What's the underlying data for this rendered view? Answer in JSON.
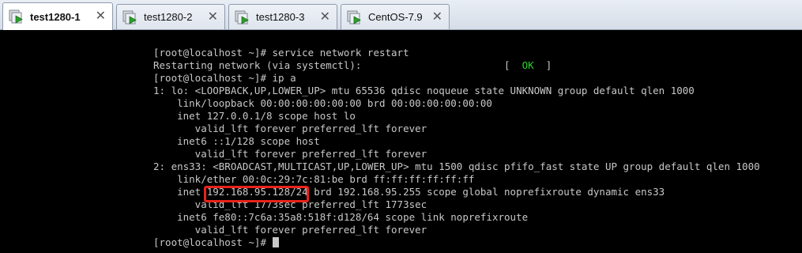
{
  "tabs": [
    {
      "label": "test1280-1",
      "active": true
    },
    {
      "label": "test1280-2",
      "active": false
    },
    {
      "label": "test1280-3",
      "active": false
    },
    {
      "label": "CentOS-7.9",
      "active": false
    }
  ],
  "tab_close_glyph": "✕",
  "terminal": {
    "lines": [
      "[root@localhost ~]# service network restart",
      "Restarting network (via systemctl):                        ",
      "[root@localhost ~]# ip a",
      "1: lo: <LOOPBACK,UP,LOWER_UP> mtu 65536 qdisc noqueue state UNKNOWN group default qlen 1000",
      "    link/loopback 00:00:00:00:00:00 brd 00:00:00:00:00:00",
      "    inet 127.0.0.1/8 scope host lo",
      "       valid_lft forever preferred_lft forever",
      "    inet6 ::1/128 scope host",
      "       valid_lft forever preferred_lft forever",
      "2: ens33: <BROADCAST,MULTICAST,UP,LOWER_UP> mtu 1500 qdisc pfifo_fast state UP group default qlen 1000",
      "    link/ether 00:0c:29:7c:81:be brd ff:ff:ff:ff:ff:ff",
      "    inet 192.168.95.128/24 brd 192.168.95.255 scope global noprefixroute dynamic ens33",
      "       valid_lft 1773sec preferred_lft 1773sec",
      "    inet6 fe80::7c6a:35a8:518f:d128/64 scope link noprefixroute",
      "       valid_lft forever preferred_lft forever",
      "[root@localhost ~]# "
    ],
    "status_open": "[  ",
    "status_ok": "OK",
    "status_close": "  ]"
  },
  "colors": {
    "terminal_bg": "#000000",
    "terminal_fg": "#c8c8c8",
    "ok_green": "#2ad12a",
    "highlight_red": "#e8231b"
  },
  "icons": {
    "tab_icon": "vm-play-icon",
    "close_icon": "close-icon"
  }
}
